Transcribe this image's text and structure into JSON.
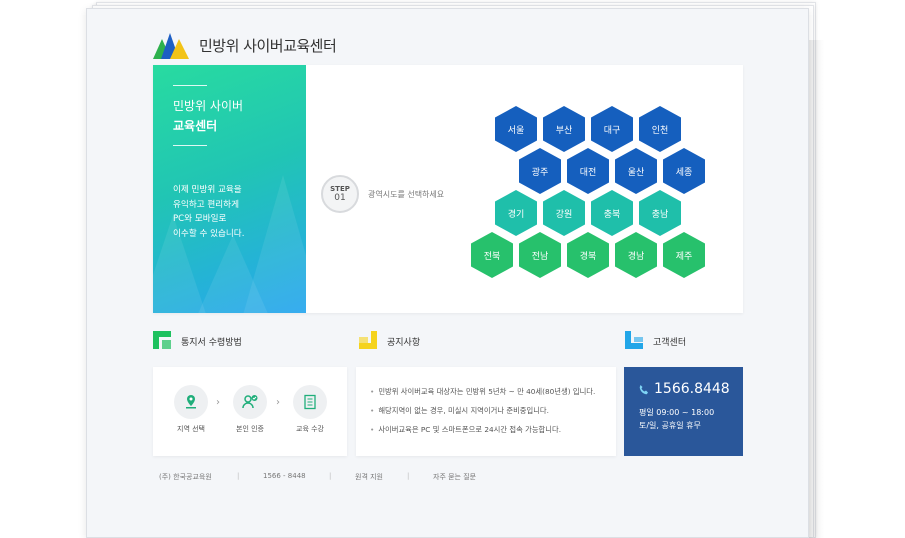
{
  "header": {
    "title": "민방위 사이버교육센터"
  },
  "hero": {
    "title_line1": "민방위 사이버",
    "title_line2": "교육센터",
    "desc": [
      "이제 민방위 교육을",
      "유익하고 편리하게",
      "PC와 모바일로",
      "이수할 수 있습니다."
    ],
    "step": {
      "label": "STEP",
      "number": "01",
      "text": "광역시도를 선택하세요"
    },
    "regions": [
      [
        "서울",
        "부산",
        "대구",
        "인천"
      ],
      [
        "광주",
        "대전",
        "울산",
        "세종"
      ],
      [
        "경기",
        "강원",
        "충북",
        "충남"
      ],
      [
        "전북",
        "전남",
        "경북",
        "경남",
        "제주"
      ]
    ]
  },
  "sections": {
    "process": {
      "title": "통지서 수령방법",
      "steps": [
        {
          "label": "지역 선택",
          "icon": "map-pin-icon"
        },
        {
          "label": "본인 인증",
          "icon": "user-check-icon"
        },
        {
          "label": "교육 수강",
          "icon": "document-icon"
        }
      ]
    },
    "notice": {
      "title": "공지사항",
      "items": [
        "민방위 사이버교육 대상자는 민방위 5년차 ~ 만 40세(80년생) 입니다.",
        "해당지역이 없는 경우, 미실시 지역이거나 준비중입니다.",
        "사이버교육은 PC 및 스마트폰으로 24시간 접속 가능합니다."
      ]
    },
    "support": {
      "title": "고객센터",
      "phone": "1566.8448",
      "hours1": "평일 09:00 ~ 18:00",
      "hours2": "토/일, 공휴일 휴무"
    }
  },
  "footer": {
    "items": [
      "(주) 한국공교육원",
      "1566 - 8448",
      "원격 지원",
      "자주 묻는 질문"
    ]
  },
  "colors": {
    "hex_blue": "#155fbe",
    "hex_teal": "#1fbfaa",
    "hex_green": "#27c16c",
    "support_bg": "#2a579a"
  }
}
